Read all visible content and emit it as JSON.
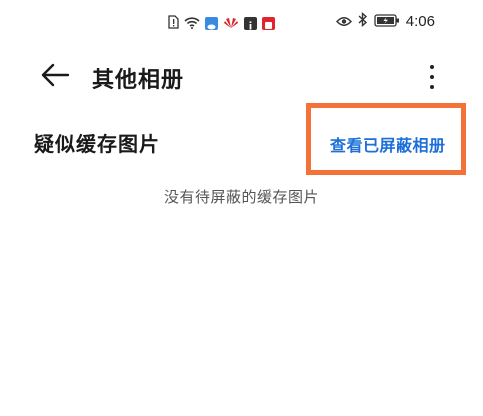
{
  "status_bar": {
    "left_icons": [
      "sim-alert-icon",
      "wifi-icon",
      "weather-icon",
      "huawei-icon",
      "info-app-icon",
      "red-app-icon"
    ],
    "right_icons": [
      "eye-icon",
      "bluetooth-icon",
      "battery-icon"
    ],
    "time": "4:06"
  },
  "app_bar": {
    "title": "其他相册",
    "back_icon": "back-arrow-icon",
    "more_icon": "more-vertical-icon"
  },
  "section": {
    "title": "疑似缓存图片",
    "action_label": "查看已屏蔽相册",
    "empty_message": "没有待屏蔽的缓存图片"
  },
  "colors": {
    "accent_link": "#1e6fd9",
    "highlight_border": "#f2723a"
  }
}
